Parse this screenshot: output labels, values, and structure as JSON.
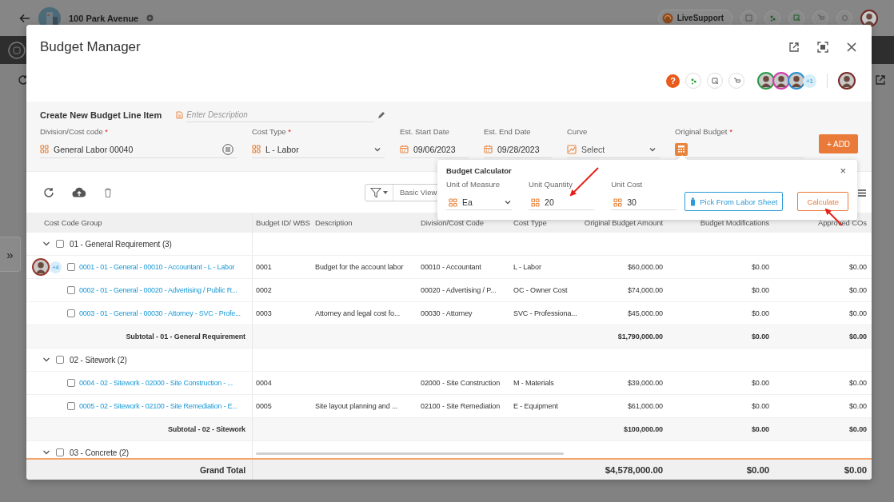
{
  "background_page": {
    "project_title": "100 Park Avenue",
    "live_support": "LiveSupport",
    "side_toggle": "»"
  },
  "modal": {
    "title": "Budget Manager",
    "help_label": "?",
    "collaborators_extra": "+1"
  },
  "form": {
    "heading": "Create New Budget Line Item",
    "description": {
      "placeholder": "Enter Description"
    },
    "fields": [
      {
        "label": "Division/Cost code",
        "required": true,
        "kind": "lookup",
        "value": "General Labor 00040"
      },
      {
        "label": "Cost Type",
        "required": true,
        "kind": "dropdown",
        "value": "L - Labor"
      },
      {
        "label": "Est. Start Date",
        "required": false,
        "kind": "date",
        "value": "09/06/2023"
      },
      {
        "label": "Est. End Date",
        "required": false,
        "kind": "date",
        "value": "09/28/2023"
      },
      {
        "label": "Curve",
        "required": false,
        "kind": "curve",
        "placeholder": "Select"
      },
      {
        "label": "Original Budget",
        "required": true,
        "kind": "calculator"
      }
    ],
    "add_button": "+ ADD",
    "required_mark": "*"
  },
  "toolbar": {
    "view": "Basic View"
  },
  "calculator": {
    "title": "Budget Calculator",
    "close": "×",
    "fields": [
      {
        "label": "Unit of Measure",
        "kind": "dropdown",
        "value": "Ea"
      },
      {
        "label": "Unit Quantity",
        "kind": "input",
        "value": "20"
      },
      {
        "label": "Unit Cost",
        "kind": "input",
        "value": "30"
      }
    ],
    "buttons": [
      {
        "label": "Pick From Labor Sheet",
        "kind": "secondary"
      },
      {
        "label": "Calculate",
        "kind": "primary"
      }
    ]
  },
  "table": {
    "columns": [
      "Cost Code Group",
      "Budget ID/ WBS",
      "Description",
      "Division/Cost Code",
      "Cost Type",
      "Original Budget Amount",
      "Budget Modifications",
      "Approved COs"
    ],
    "rows": [
      {
        "kind": "group",
        "label": "01 - General Requirement (3)",
        "expanded": true,
        "checked": false
      },
      {
        "kind": "item",
        "label": "0001 - 01 - General - 00010 - Accountant - L - Labor",
        "checked": false,
        "assignees_extra": "+4",
        "budget_id": "0001",
        "description": "Budget for the account labor",
        "division_cost_code": "00010 - Accountant",
        "cost_type": "L - Labor",
        "original_budget_amount": "$60,000.00",
        "budget_modifications": "$0.00",
        "approved_cos": "$0.00"
      },
      {
        "kind": "item",
        "label": "0002 - 01 - General - 00020 - Advertising / Public R...",
        "checked": false,
        "budget_id": "0002",
        "division_cost_code": "00020 - Advertising / P...",
        "cost_type": "OC - Owner Cost",
        "original_budget_amount": "$74,000.00",
        "budget_modifications": "$0.00",
        "approved_cos": "$0.00"
      },
      {
        "kind": "item",
        "label": "0003 - 01 - General - 00030 - Attorney - SVC - Profe...",
        "checked": false,
        "budget_id": "0003",
        "description": "Attorney and legal cost fo...",
        "division_cost_code": "00030 - Attorney",
        "cost_type": "SVC - Professiona...",
        "original_budget_amount": "$45,000.00",
        "budget_modifications": "$0.00",
        "approved_cos": "$0.00"
      },
      {
        "kind": "subtotal",
        "label": "Subtotal - 01 - General Requirement",
        "original_budget_amount": "$1,790,000.00",
        "budget_modifications": "$0.00",
        "approved_cos": "$0.00"
      },
      {
        "kind": "group",
        "label": "02 - Sitework (2)",
        "expanded": true,
        "checked": false
      },
      {
        "kind": "item",
        "label": "0004 - 02 - Sitework - 02000 - Site Construction - ...",
        "checked": false,
        "budget_id": "0004",
        "division_cost_code": "02000 - Site Construction",
        "cost_type": "M - Materials",
        "original_budget_amount": "$39,000.00",
        "budget_modifications": "$0.00",
        "approved_cos": "$0.00"
      },
      {
        "kind": "item",
        "label": "0005 - 02 - Sitework - 02100 - Site Remediation - E...",
        "checked": false,
        "budget_id": "0005",
        "description": "Site layout planning and ...",
        "division_cost_code": "02100 - Site Remediation",
        "cost_type": "E - Equipment",
        "original_budget_amount": "$61,000.00",
        "budget_modifications": "$0.00",
        "approved_cos": "$0.00"
      },
      {
        "kind": "subtotal",
        "label": "Subtotal - 02 - Sitework",
        "original_budget_amount": "$100,000.00",
        "budget_modifications": "$0.00",
        "approved_cos": "$0.00"
      },
      {
        "kind": "group",
        "label": "03 - Concrete (2)",
        "expanded": true,
        "checked": false
      }
    ],
    "footer": {
      "label": "Grand Total",
      "original_budget_amount": "$4,578,000.00",
      "budget_modifications": "$0.00",
      "approved_cos": "$0.00"
    }
  }
}
